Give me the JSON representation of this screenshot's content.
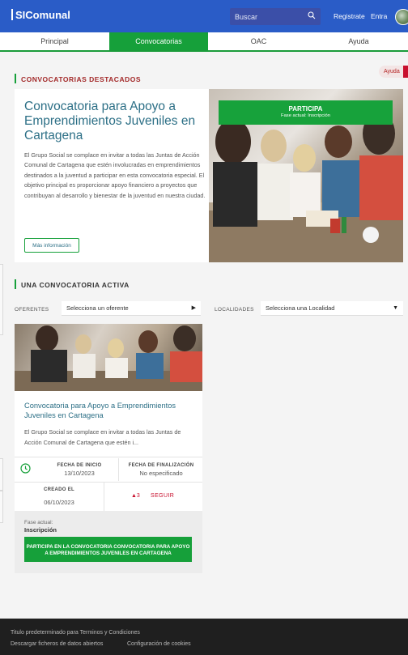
{
  "header": {
    "brand": "SIComunal",
    "search_placeholder": "Buscar",
    "register": "Registrate",
    "login": "Entra",
    "icons": {
      "search": "search-icon",
      "avatar": "user-avatar"
    }
  },
  "nav": {
    "tabs": [
      {
        "label": "Principal",
        "active": false
      },
      {
        "label": "Convocatorias",
        "active": true
      },
      {
        "label": "OAC",
        "active": false
      },
      {
        "label": "Ayuda",
        "active": false
      }
    ]
  },
  "featured": {
    "section_title": "CONVOCATORIAS DESTACADOS",
    "help_badge": "Ayuda",
    "title": "Convocatoria para Apoyo a Emprendimientos Juveniles en Cartagena",
    "description": "El Grupo Social se complace en invitar a todas las Juntas de Acción Comunal de Cartagena que estén involucradas en emprendimientos destinados a la juventud a participar en esta convocatoria especial. El objetivo principal es proporcionar apoyo financiero a proyectos que contribuyan al desarrollo y bienestar de la juventud en nuestra ciudad.",
    "more_button": "Más información",
    "banner_title": "PARTICIPA",
    "banner_subtitle": "Fase actual: Inscripción"
  },
  "active": {
    "section_title": "UNA CONVOCATORIA ACTIVA",
    "filters": {
      "oferentes_label": "OFERENTES",
      "oferentes_value": "Selecciona un oferente",
      "localidades_label": "LOCALIDADES",
      "localidades_value": "Selecciona una Localidad"
    },
    "card": {
      "title": "Convocatoria para Apoyo a Emprendimientos Juveniles en Cartagena",
      "description": "El Grupo Social se complace en invitar a todas las Juntas de Acción Comunal de Cartagena que estén i...",
      "start_label": "FECHA DE INICIO",
      "start_value": "13/10/2023",
      "end_label": "FECHA DE FINALIZACIÓN",
      "end_value": "No especificado",
      "created_label": "CREADO EL",
      "created_value": "06/10/2023",
      "votes": "▲3",
      "follow": "SEGUIR",
      "phase_label": "Fase actual:",
      "phase_value": "Inscripción",
      "join_button": "PARTICIPA EN LA CONVOCATORIA CONVOCATORIA PARA APOYO A EMPRENDIMIENTOS JUVENILES EN CARTAGENA"
    }
  },
  "footer": {
    "terms": "Titulo predeterminado para Terminos y Condiciones",
    "open_data": "Descargar ficheros de datos abiertos",
    "cookies": "Configuración de cookies"
  },
  "colors": {
    "header_blue": "#2a5cc7",
    "accent_green": "#16a03a",
    "title_teal": "#2c6f86",
    "alert_red": "#c8102e",
    "footer_dark": "#1f1f1f"
  }
}
